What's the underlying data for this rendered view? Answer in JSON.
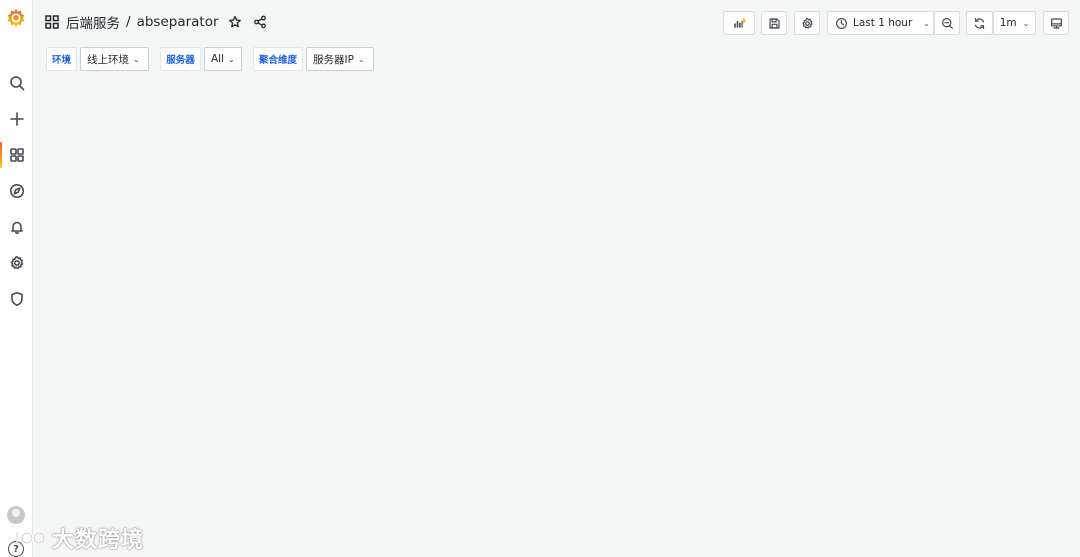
{
  "sidebar": {
    "items": [
      {
        "name": "search-icon"
      },
      {
        "name": "plus-icon"
      },
      {
        "name": "dashboards-icon",
        "active": true
      },
      {
        "name": "explore-icon"
      },
      {
        "name": "bell-icon"
      },
      {
        "name": "gear-icon"
      },
      {
        "name": "shield-icon"
      }
    ],
    "help_glyph": "?"
  },
  "breadcrumb": {
    "folder": "后端服务",
    "separator": "/",
    "dashboard": "abseparator"
  },
  "toolbar": {
    "time_range": "Last 1 hour",
    "refresh_interval": "1m"
  },
  "variables": [
    {
      "label": "环境",
      "value": "线上环境"
    },
    {
      "label": "服务器",
      "value": "All"
    },
    {
      "label": "聚合维度",
      "value": "服务器IP"
    }
  ],
  "watermark": {
    "text": "大数跨境"
  },
  "colors": {
    "background": "#f4f5f5",
    "variable_label": "#1f62e0",
    "brand_orange": "#f05a28"
  }
}
